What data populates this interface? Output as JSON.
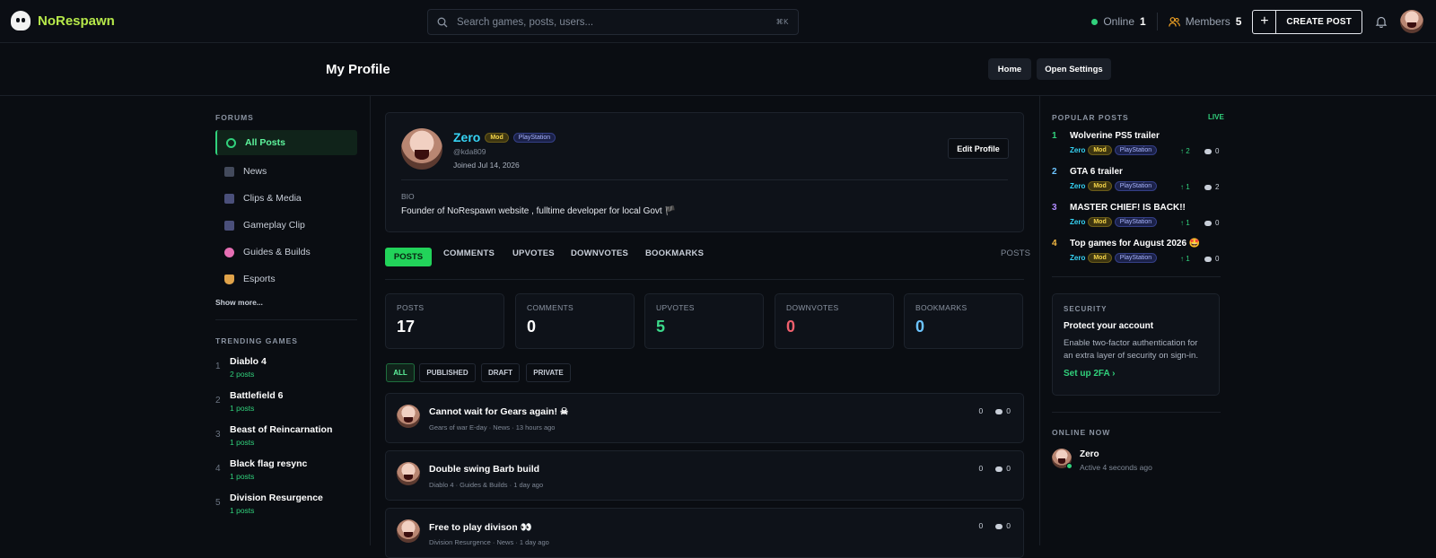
{
  "app": {
    "name": "NoRespawn"
  },
  "search": {
    "placeholder": "Search games, posts, users...",
    "shortcut": "⌘K"
  },
  "topbar": {
    "online_label": "Online",
    "online_count": "1",
    "members_label": "Members",
    "members_count": "5",
    "create_label": "CREATE POST",
    "create_icon": "+"
  },
  "header": {
    "title": "My Profile",
    "home_label": "Home",
    "settings_label": "Open Settings"
  },
  "sidebar": {
    "forums_title": "FORUMS",
    "forums": [
      {
        "label": "All Posts"
      },
      {
        "label": "News"
      },
      {
        "label": "Clips & Media"
      },
      {
        "label": "Gameplay Clip"
      },
      {
        "label": "Guides & Builds"
      },
      {
        "label": "Esports"
      }
    ],
    "show_more": "Show more...",
    "trending_title": "TRENDING GAMES",
    "games": [
      {
        "rank": "1",
        "name": "Diablo 4",
        "count": "2 posts"
      },
      {
        "rank": "2",
        "name": "Battlefield 6",
        "count": "1 posts"
      },
      {
        "rank": "3",
        "name": "Beast of Reincarnation",
        "count": "1 posts"
      },
      {
        "rank": "4",
        "name": "Black flag resync",
        "count": "1 posts"
      },
      {
        "rank": "5",
        "name": "Division Resurgence",
        "count": "1 posts"
      }
    ]
  },
  "profile": {
    "name": "Zero",
    "badge_mod": "Mod",
    "badge_platform": "PlayStation",
    "handle": "@kda809",
    "joined": "Joined Jul 14, 2026",
    "edit_label": "Edit Profile",
    "bio_label": "BIO",
    "bio": "Founder of NoRespawn website , fulltime developer for local Govt 🏴"
  },
  "tabs": {
    "posts": "POSTS",
    "comments": "COMMENTS",
    "upvotes": "UPVOTES",
    "downvotes": "DOWNVOTES",
    "bookmarks": "BOOKMARKS",
    "right_label": "POSTS"
  },
  "stats": [
    {
      "label": "POSTS",
      "value": "17",
      "color": "#ffffff"
    },
    {
      "label": "COMMENTS",
      "value": "0",
      "color": "#ffffff"
    },
    {
      "label": "UPVOTES",
      "value": "5",
      "color": "#3bd98a"
    },
    {
      "label": "DOWNVOTES",
      "value": "0",
      "color": "#f0606d"
    },
    {
      "label": "BOOKMARKS",
      "value": "0",
      "color": "#6cc4ff"
    }
  ],
  "filters": {
    "all": "ALL",
    "published": "PUBLISHED",
    "draft": "DRAFT",
    "private": "PRIVATE"
  },
  "posts": [
    {
      "title": "Cannot wait for Gears again! ☠",
      "meta": "Gears of war E-day · News · 13 hours ago",
      "votes": "0",
      "comments": "0"
    },
    {
      "title": "Double swing Barb build",
      "meta": "Diablo 4 · Guides & Builds · 1 day ago",
      "votes": "0",
      "comments": "0"
    },
    {
      "title": "Free to play divison 👀",
      "meta": "Division Resurgence · News · 1 day ago",
      "votes": "0",
      "comments": "0"
    }
  ],
  "popular": {
    "title": "POPULAR POSTS",
    "live": "LIVE",
    "items": [
      {
        "rank": "1",
        "title": "Wolverine PS5 trailer",
        "user": "Zero",
        "mod": "Mod",
        "platform": "PlayStation",
        "up": "↑ 2",
        "comments": "0",
        "color": "#31d17c"
      },
      {
        "rank": "2",
        "title": "GTA 6 trailer",
        "user": "Zero",
        "mod": "Mod",
        "platform": "PlayStation",
        "up": "↑ 1",
        "comments": "2",
        "color": "#6cc4ff"
      },
      {
        "rank": "3",
        "title": "MASTER CHIEF! IS BACK!!",
        "user": "Zero",
        "mod": "Mod",
        "platform": "PlayStation",
        "up": "↑ 1",
        "comments": "0",
        "color": "#b18cff"
      },
      {
        "rank": "4",
        "title": "Top games for August 2026 🤩",
        "user": "Zero",
        "mod": "Mod",
        "platform": "PlayStation",
        "up": "↑ 1",
        "comments": "0",
        "color": "#f5b942"
      }
    ]
  },
  "security": {
    "label": "SECURITY",
    "title": "Protect your account",
    "text": "Enable two-factor authentication for an extra layer of security on sign-in.",
    "link": "Set up 2FA"
  },
  "online_now": {
    "title": "ONLINE NOW",
    "user": "Zero",
    "status": "Active 4 seconds ago"
  }
}
